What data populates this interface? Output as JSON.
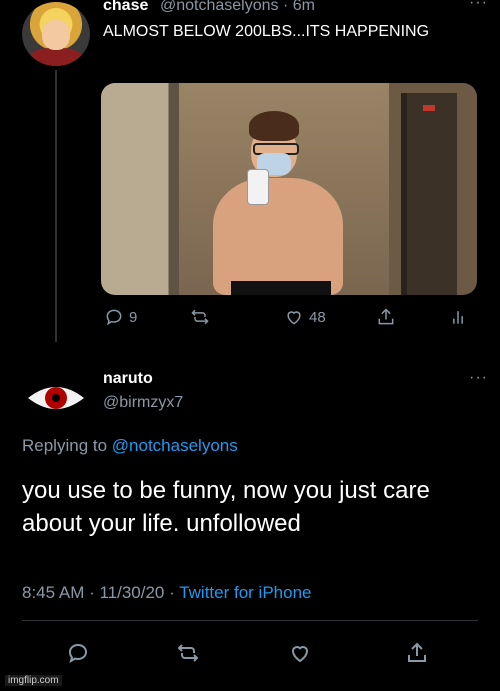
{
  "tweet": {
    "display_name": "chase",
    "handle_time": "@notchaselyons · 6m",
    "more": "···",
    "text": "ALMOST BELOW 200LBS...ITS HAPPENING",
    "reply_count": "9",
    "like_count": "48"
  },
  "reply": {
    "display_name": "naruto",
    "handle": "@birmzyx7",
    "more": "···",
    "replying_label": "Replying to",
    "replying_handle": "@notchaselyons",
    "text": "you use to be funny, now you just care about your life. unfollowed",
    "timestamp": "8:45 AM · 11/30/20 · ",
    "source": "Twitter for iPhone"
  },
  "watermark": "imgflip.com",
  "colors": {
    "background": "#000000",
    "link": "#1d9bf0",
    "muted": "#8b98a5"
  }
}
